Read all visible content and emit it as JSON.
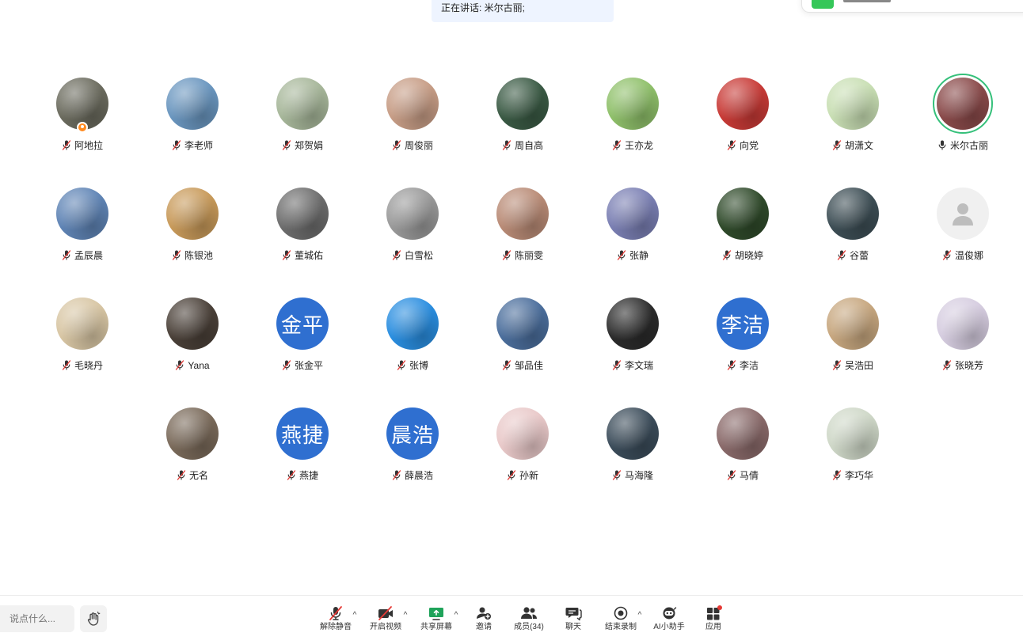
{
  "speaking": {
    "text": "正在讲话: 米尔古丽;"
  },
  "participants": [
    {
      "name": "阿地拉",
      "mic": "muted",
      "avatar": "photo",
      "avatar_color": "#6b6b5e",
      "host": true
    },
    {
      "name": "李老师",
      "mic": "muted",
      "avatar": "photo",
      "avatar_color": "#6a96bf"
    },
    {
      "name": "郑贺娟",
      "mic": "muted",
      "avatar": "photo",
      "avatar_color": "#a7b79a"
    },
    {
      "name": "周俊丽",
      "mic": "muted",
      "avatar": "photo",
      "avatar_color": "#c79d86"
    },
    {
      "name": "周自高",
      "mic": "muted",
      "avatar": "photo",
      "avatar_color": "#3a5a44"
    },
    {
      "name": "王亦龙",
      "mic": "muted",
      "avatar": "photo",
      "avatar_color": "#8fc06a"
    },
    {
      "name": "向党",
      "mic": "muted",
      "avatar": "photo",
      "avatar_color": "#c83a36"
    },
    {
      "name": "胡潇文",
      "mic": "muted",
      "avatar": "photo",
      "avatar_color": "#c9dfb4"
    },
    {
      "name": "米尔古丽",
      "mic": "on",
      "avatar": "photo",
      "avatar_color": "#8a4a4a",
      "speaking": true
    },
    {
      "name": "孟辰晨",
      "mic": "muted",
      "avatar": "photo",
      "avatar_color": "#5f84b5"
    },
    {
      "name": "陈银池",
      "mic": "muted",
      "avatar": "photo",
      "avatar_color": "#c89a5a"
    },
    {
      "name": "董城佑",
      "mic": "muted",
      "avatar": "photo",
      "avatar_color": "#6d6d6d"
    },
    {
      "name": "白雪松",
      "mic": "muted",
      "avatar": "photo",
      "avatar_color": "#9a9a9a"
    },
    {
      "name": "陈丽雯",
      "mic": "muted",
      "avatar": "photo",
      "avatar_color": "#b98b76"
    },
    {
      "name": "张静",
      "mic": "muted",
      "avatar": "photo",
      "avatar_color": "#7a7fb3"
    },
    {
      "name": "胡晓婷",
      "mic": "muted",
      "avatar": "photo",
      "avatar_color": "#2f4a2a"
    },
    {
      "name": "谷蕾",
      "mic": "muted",
      "avatar": "photo",
      "avatar_color": "#3d4e55"
    },
    {
      "name": "温俊娜",
      "mic": "muted",
      "avatar": "default",
      "avatar_color": "#f0f0f0"
    },
    {
      "name": "毛晓丹",
      "mic": "muted",
      "avatar": "photo",
      "avatar_color": "#d8c6a4"
    },
    {
      "name": "Yana",
      "mic": "muted",
      "avatar": "photo",
      "avatar_color": "#4a4038"
    },
    {
      "name": "张金平",
      "mic": "muted",
      "avatar": "text",
      "avatar_text": "金平",
      "avatar_color": "#2f6fd0"
    },
    {
      "name": "张博",
      "mic": "muted",
      "avatar": "photo",
      "avatar_color": "#2a8ee0"
    },
    {
      "name": "邹品佳",
      "mic": "muted",
      "avatar": "photo",
      "avatar_color": "#4b6e9c"
    },
    {
      "name": "李文瑞",
      "mic": "muted",
      "avatar": "photo",
      "avatar_color": "#2b2b2b"
    },
    {
      "name": "李洁",
      "mic": "muted",
      "avatar": "text",
      "avatar_text": "李洁",
      "avatar_color": "#2f6fd0"
    },
    {
      "name": "吴浩田",
      "mic": "muted",
      "avatar": "photo",
      "avatar_color": "#c7a77f"
    },
    {
      "name": "张晓芳",
      "mic": "muted",
      "avatar": "photo",
      "avatar_color": "#d6cde0"
    },
    {
      "name": "无名",
      "mic": "muted",
      "avatar": "photo",
      "avatar_color": "#7a6a5a"
    },
    {
      "name": "燕捷",
      "mic": "muted",
      "avatar": "text",
      "avatar_text": "燕捷",
      "avatar_color": "#2f6fd0"
    },
    {
      "name": "薛晨浩",
      "mic": "muted",
      "avatar": "text",
      "avatar_text": "晨浩",
      "avatar_color": "#2f6fd0"
    },
    {
      "name": "孙新",
      "mic": "muted",
      "avatar": "photo",
      "avatar_color": "#e9c9c9"
    },
    {
      "name": "马海隆",
      "mic": "muted",
      "avatar": "photo",
      "avatar_color": "#3b4c5a"
    },
    {
      "name": "马倩",
      "mic": "muted",
      "avatar": "photo",
      "avatar_color": "#8a6a6a"
    },
    {
      "name": "李巧华",
      "mic": "muted",
      "avatar": "photo",
      "avatar_color": "#cfd8c8"
    }
  ],
  "toolbar": {
    "chat_placeholder": "说点什么...",
    "unmute_label": "解除静音",
    "video_label": "开启视频",
    "share_label": "共享屏幕",
    "invite_label": "邀请",
    "members_label": "成员(34)",
    "chat_label": "聊天",
    "record_label": "结束录制",
    "ai_label": "AI小助手",
    "apps_label": "应用",
    "danger_color": "#e53935",
    "share_color": "#1fa35a"
  }
}
